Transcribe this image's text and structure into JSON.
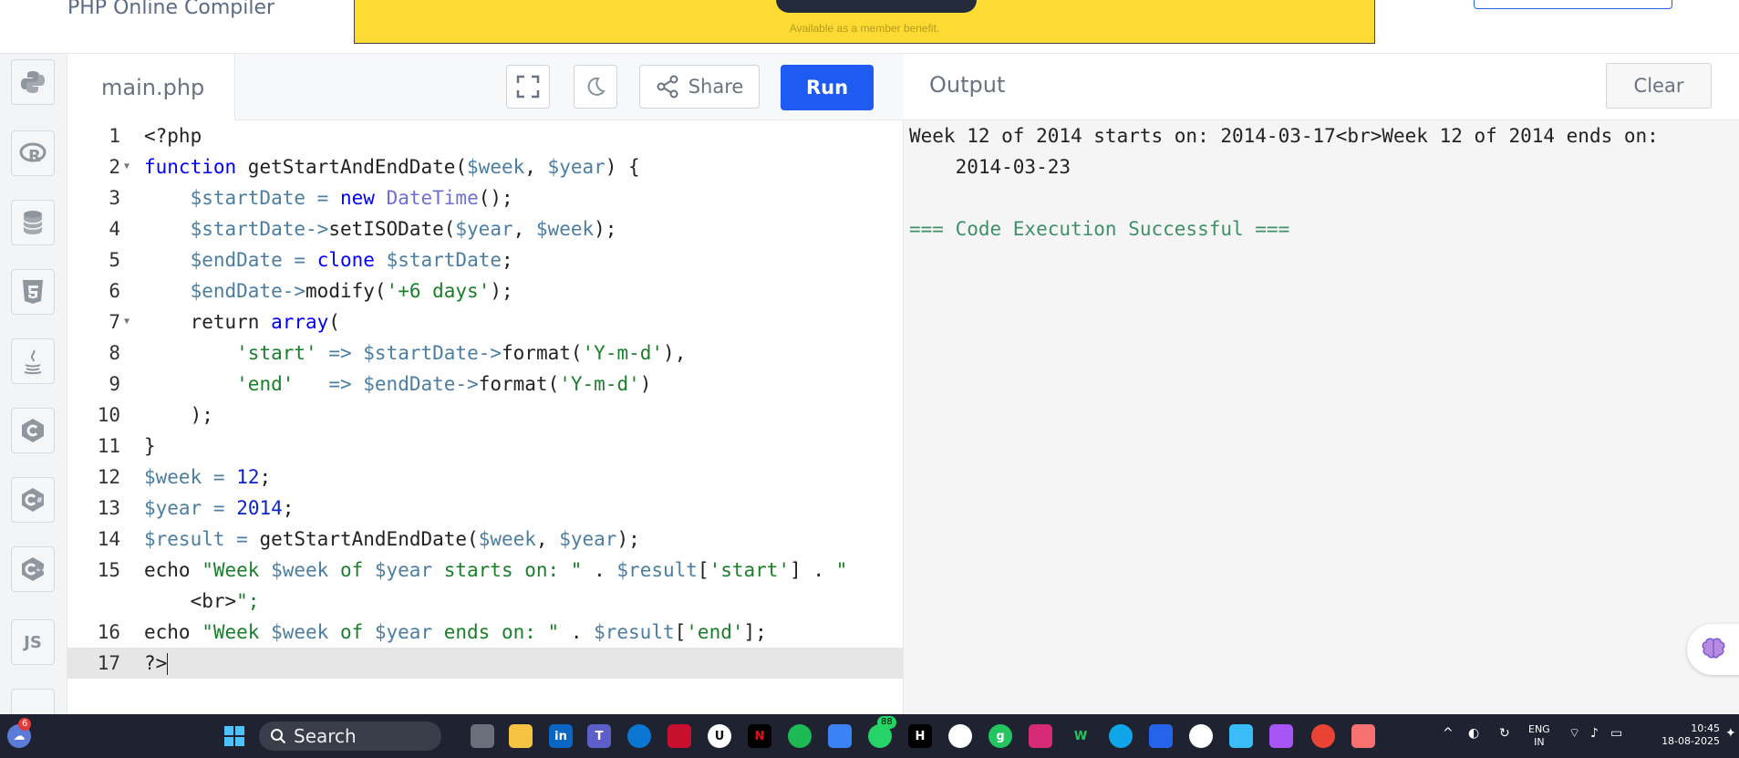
{
  "header": {
    "brand": "PHP Online Compiler",
    "ad_text": "Available as a member benefit."
  },
  "rail": {
    "items": [
      "python-icon",
      "r-icon",
      "database-icon",
      "html5-icon",
      "java-icon",
      "c-icon",
      "csharp-icon",
      "cpp-icon",
      "javascript-icon"
    ],
    "js_label": "JS"
  },
  "editor": {
    "file_tab": "main.php",
    "share_label": "Share",
    "run_label": "Run",
    "active_line": 17
  },
  "code_lines": [
    "<?php",
    "function getStartAndEndDate($week, $year) {",
    "    $startDate = new DateTime();",
    "    $startDate->setISODate($year, $week);",
    "    $endDate = clone $startDate;",
    "    $endDate->modify('+6 days');",
    "    return array(",
    "        'start' => $startDate->format('Y-m-d'),",
    "        'end'   => $endDate->format('Y-m-d')",
    "    );",
    "}",
    "$week = 12;",
    "$year = 2014;",
    "$result = getStartAndEndDate($week, $year);",
    "echo \"Week $week of $year starts on: \" . $result['start'] . \"",
    "    <br>\";",
    "echo \"Week $week of $year ends on: \" . $result['end'];",
    "?>"
  ],
  "line_numbers": [
    "1",
    "2",
    "3",
    "4",
    "5",
    "6",
    "7",
    "8",
    "9",
    "10",
    "11",
    "12",
    "13",
    "14",
    "15",
    "",
    "16",
    "17"
  ],
  "output": {
    "title": "Output",
    "clear_label": "Clear",
    "lines": [
      "Week 12 of 2014 starts on: 2014-03-17<br>Week 12 of 2014 ends on:",
      "    2014-03-23",
      "",
      "=== Code Execution Successful ==="
    ]
  },
  "taskbar": {
    "search_label": "Search",
    "weather_badge": "6",
    "whatsapp_badge": "88",
    "lang_top": "ENG",
    "lang_bottom": "IN",
    "time": "10:45",
    "date": "18-08-2025"
  },
  "colors": {
    "run_button": "#1d5bf2",
    "ad_banner": "#fddb33",
    "keyword": "#0000ff",
    "variable": "#4b7ea1",
    "string": "#1a7f2a",
    "success": "#3f8f6a"
  }
}
